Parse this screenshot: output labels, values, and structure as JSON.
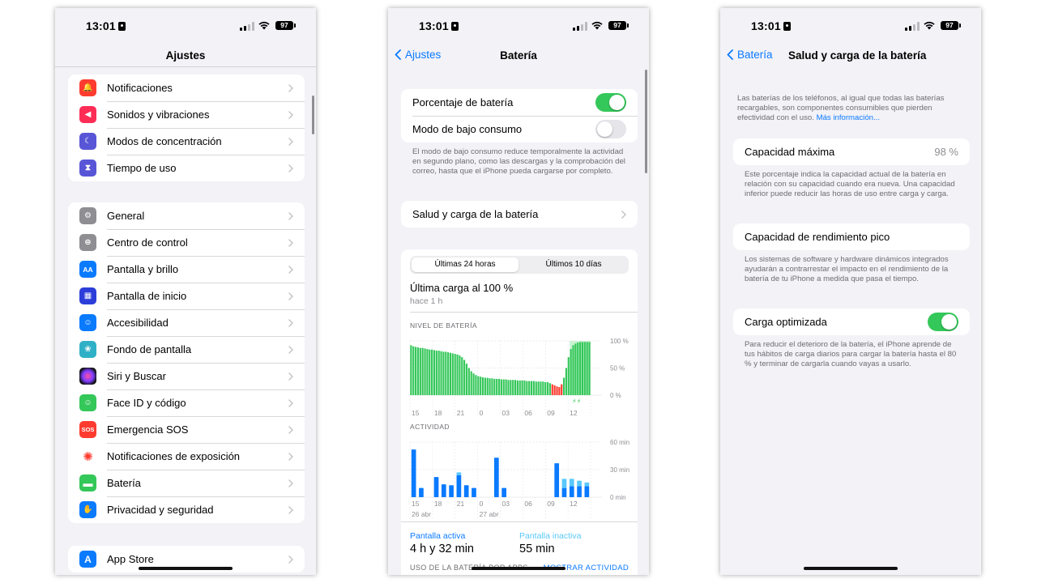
{
  "status": {
    "time": "13:01",
    "battery": "97"
  },
  "settings": {
    "title": "Ajustes",
    "group1": [
      {
        "label": "Notificaciones",
        "icon": "bell-icon",
        "color": "#ff3b30"
      },
      {
        "label": "Sonidos y vibraciones",
        "icon": "speaker-icon",
        "color": "#ff2d55"
      },
      {
        "label": "Modos de concentración",
        "icon": "moon-icon",
        "color": "#5856d6"
      },
      {
        "label": "Tiempo de uso",
        "icon": "hourglass-icon",
        "color": "#5856d6"
      }
    ],
    "group2": [
      {
        "label": "General",
        "icon": "gear-icon",
        "color": "#8e8e93"
      },
      {
        "label": "Centro de control",
        "icon": "switches-icon",
        "color": "#8e8e93"
      },
      {
        "label": "Pantalla y brillo",
        "icon": "text-size-icon",
        "color": "#0a7aff"
      },
      {
        "label": "Pantalla de inicio",
        "icon": "home-grid-icon",
        "color": "#2c3ed9"
      },
      {
        "label": "Accesibilidad",
        "icon": "accessibility-icon",
        "color": "#0a7aff"
      },
      {
        "label": "Fondo de pantalla",
        "icon": "flower-icon",
        "color": "#30b0c7"
      },
      {
        "label": "Siri y Buscar",
        "icon": "siri-icon",
        "color": "#222"
      },
      {
        "label": "Face ID y código",
        "icon": "face-id-icon",
        "color": "#34c759"
      },
      {
        "label": "Emergencia SOS",
        "icon": "sos-icon",
        "color": "#ff3b30"
      },
      {
        "label": "Notificaciones de exposición",
        "icon": "exposure-icon",
        "color": "#ff3b30"
      },
      {
        "label": "Batería",
        "icon": "battery-icon",
        "color": "#34c759"
      },
      {
        "label": "Privacidad y seguridad",
        "icon": "hand-icon",
        "color": "#0a7aff"
      }
    ],
    "group3": [
      {
        "label": "App Store",
        "icon": "app-store-icon",
        "color": "#0a7aff"
      }
    ]
  },
  "battery": {
    "back_label": "Ajustes",
    "title": "Batería",
    "percentage_label": "Porcentaje de batería",
    "low_power_label": "Modo de bajo consumo",
    "low_power_note": "El modo de bajo consumo reduce temporalmente la actividad en segundo plano, como las descargas y la comprobación del correo, hasta que el iPhone pueda cargarse por completo.",
    "health_label": "Salud y carga de la batería",
    "tab_24h": "Últimas 24 horas",
    "tab_10d": "Últimos 10 días",
    "last_charge": "Última carga al 100 %",
    "last_charge_ago": "hace 1 h",
    "level_heading": "NIVEL DE BATERÍA",
    "activity_heading": "ACTIVIDAD",
    "screen_active_label": "Pantalla activa",
    "screen_active_value": "4 h y 32 min",
    "screen_inactive_label": "Pantalla inactiva",
    "screen_inactive_value": "55 min",
    "usage_heading": "USO DE LA BATERÍA POR APPS",
    "show_activity": "MOSTRAR ACTIVIDAD",
    "colors": {
      "green": "#34c759",
      "red": "#ff3b30",
      "blue": "#0a7aff",
      "light_blue": "#5ac8fa"
    }
  },
  "chart_data": [
    {
      "type": "bar",
      "title": "NIVEL DE BATERÍA",
      "x_tick_labels": [
        "15",
        "18",
        "21",
        "0",
        "03",
        "06",
        "09",
        "12"
      ],
      "y_tick_labels": [
        "100 %",
        "50 %",
        "0 %"
      ],
      "ylim": [
        0,
        100
      ],
      "values": [
        92,
        90,
        89,
        88,
        87,
        87,
        86,
        85,
        84,
        84,
        83,
        82,
        82,
        81,
        80,
        80,
        79,
        78,
        77,
        76,
        75,
        73,
        70,
        65,
        58,
        50,
        44,
        40,
        37,
        35,
        34,
        33,
        32,
        32,
        31,
        31,
        30,
        30,
        30,
        29,
        29,
        29,
        28,
        28,
        28,
        28,
        27,
        27,
        27,
        27,
        26,
        26,
        26,
        26,
        25,
        25,
        25,
        25,
        24,
        24,
        22,
        20,
        18,
        16,
        15,
        20,
        32,
        50,
        70,
        85,
        92,
        95,
        97,
        98,
        98,
        98,
        98,
        98
      ],
      "charging_highlight": [
        69,
        78
      ]
    },
    {
      "type": "bar",
      "title": "ACTIVIDAD",
      "x_tick_labels": [
        "15",
        "18",
        "21",
        "0",
        "03",
        "06",
        "09",
        "12"
      ],
      "date_labels": [
        "26 abr",
        "27 abr"
      ],
      "y_tick_labels": [
        "60 min",
        "30 min",
        "0 min"
      ],
      "ylim": [
        0,
        60
      ],
      "series": [
        {
          "name": "Pantalla activa",
          "values": [
            52,
            10,
            0,
            22,
            14,
            13,
            24,
            13,
            10,
            0,
            0,
            43,
            10,
            0,
            0,
            0,
            0,
            0,
            0,
            37,
            10,
            12,
            12,
            12
          ]
        },
        {
          "name": "Pantalla inactiva",
          "values": [
            0,
            0,
            0,
            0,
            0,
            0,
            3,
            0,
            0,
            0,
            0,
            0,
            0,
            0,
            0,
            0,
            0,
            0,
            0,
            0,
            10,
            8,
            6,
            4
          ]
        }
      ]
    }
  ],
  "health": {
    "back_label": "Batería",
    "title": "Salud y carga de la batería",
    "intro": "Las baterías de los teléfonos, al igual que todas las baterías recargables, son componentes consumibles que pierden efectividad con el uso.",
    "more_info": "Más información...",
    "max_capacity_label": "Capacidad máxima",
    "max_capacity_value": "98 %",
    "max_capacity_note": "Este porcentaje indica la capacidad actual de la batería en relación con su capacidad cuando era nueva. Una capacidad inferior puede reducir las horas de uso entre carga y carga.",
    "peak_label": "Capacidad de rendimiento pico",
    "peak_note": "Los sistemas de software y hardware dinámicos integrados ayudarán a contrarrestar el impacto en el rendimiento de la batería de tu iPhone a medida que pasa el tiempo.",
    "optimized_label": "Carga optimizada",
    "optimized_note": "Para reducir el deterioro de la batería, el iPhone aprende de tus hábitos de carga diarios para cargar la batería hasta el 80 % y terminar de cargarla cuando vayas a usarlo."
  }
}
